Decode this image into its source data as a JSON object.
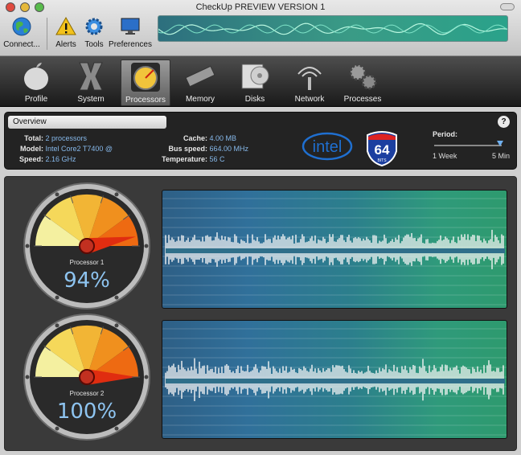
{
  "window": {
    "title": "CheckUp PREVIEW VERSION 1"
  },
  "toolbar": [
    {
      "label": "Connect...",
      "icon": "globe-icon"
    },
    {
      "label": "Alerts",
      "icon": "alert-icon"
    },
    {
      "label": "Tools",
      "icon": "gear-icon"
    },
    {
      "label": "Preferences",
      "icon": "monitor-icon"
    }
  ],
  "tabs": [
    {
      "label": "Profile",
      "icon": "apple-icon"
    },
    {
      "label": "System",
      "icon": "os-x-icon"
    },
    {
      "label": "Processors",
      "icon": "processor-gauge-icon",
      "active": true
    },
    {
      "label": "Memory",
      "icon": "memory-chip-icon"
    },
    {
      "label": "Disks",
      "icon": "disk-icon"
    },
    {
      "label": "Network",
      "icon": "antenna-icon"
    },
    {
      "label": "Processes",
      "icon": "gears-icon"
    }
  ],
  "overview": {
    "title": "Overview",
    "help": "?",
    "total_label": "Total:",
    "total_value": "2 processors",
    "model_label": "Model:",
    "model_value": "Intel Core2 T7400 @",
    "speed_label": "Speed:",
    "speed_value": "2.16 GHz",
    "cache_label": "Cache:",
    "cache_value": "4.00 MB",
    "bus_label": "Bus speed:",
    "bus_value": "664.00 MHz",
    "temp_label": "Temperature:",
    "temp_value": "56 C",
    "intel_logo": "intel",
    "bits_logo": "64",
    "bits_sub": "BITS"
  },
  "period": {
    "label": "Period:",
    "min_label": "1 Week",
    "max_label": "5 Min",
    "value": 1.0
  },
  "processors": [
    {
      "name": "Processor 1",
      "percent_text": "94%",
      "load": 0.94
    },
    {
      "name": "Processor 2",
      "percent_text": "100%",
      "load": 1.0
    }
  ],
  "colors": {
    "accent_blue": "#86b8ea",
    "graph_left": "#2e5f86",
    "graph_right": "#2e9a6e",
    "bolt": "#e02d10"
  }
}
